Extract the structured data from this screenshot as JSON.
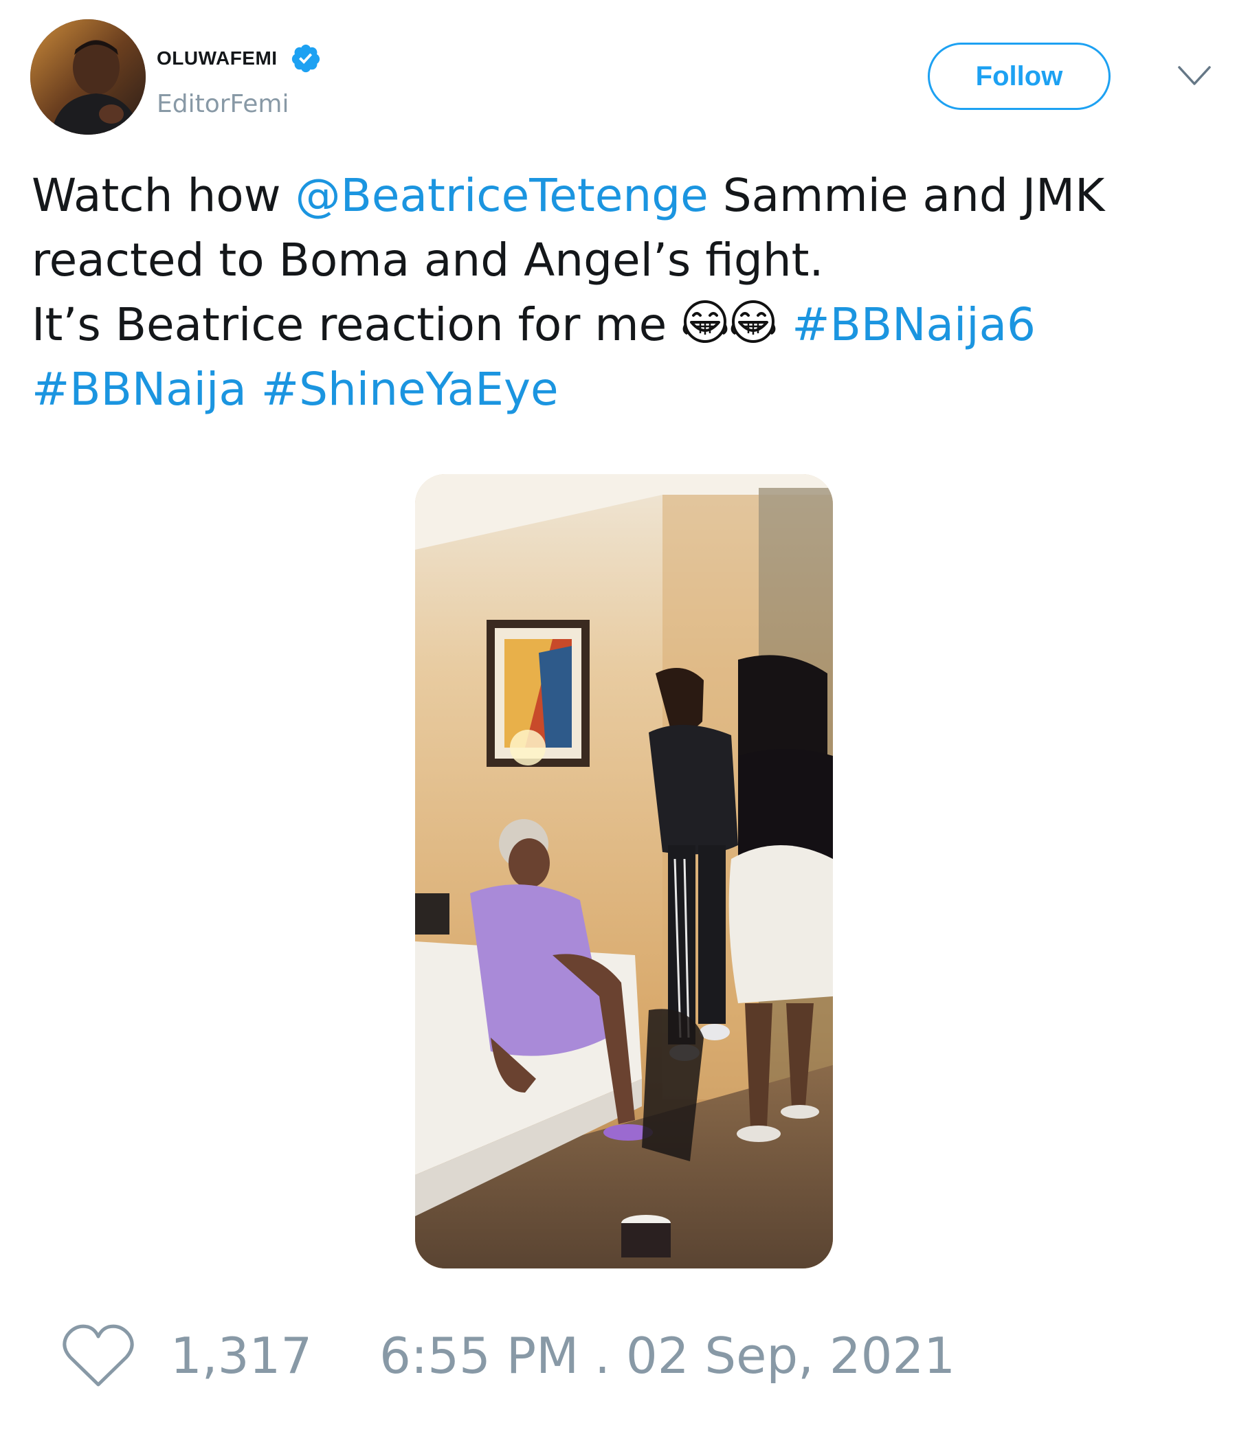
{
  "author": {
    "display_name": "OLUWAFEMI",
    "handle": "EditorFemi",
    "verified": true,
    "avatar_icon": "profile-photo"
  },
  "actions": {
    "follow_label": "Follow",
    "menu_icon": "chevron-down-icon"
  },
  "tweet": {
    "line1_prefix": "Watch how ",
    "mention": "@BeatriceTetenge",
    "line1_suffix": " Sammie and JMK",
    "line2": "reacted to Boma and Angel’s fight.",
    "line3_text": "It’s Beatrice reaction for me ",
    "emoji": "face-with-tears-of-joy",
    "hashtags": [
      "#BBNaija6",
      "#BBNaija",
      "#ShineYaEye"
    ]
  },
  "media": {
    "type": "video-thumbnail"
  },
  "footer": {
    "like_icon": "heart-icon",
    "like_count": "1,317",
    "timestamp": "6:55 PM . 02 Sep, 2021"
  },
  "colors": {
    "link": "#1b95e0",
    "follow_border": "#1da1f2",
    "muted": "#8899a6",
    "text": "#14171a"
  }
}
